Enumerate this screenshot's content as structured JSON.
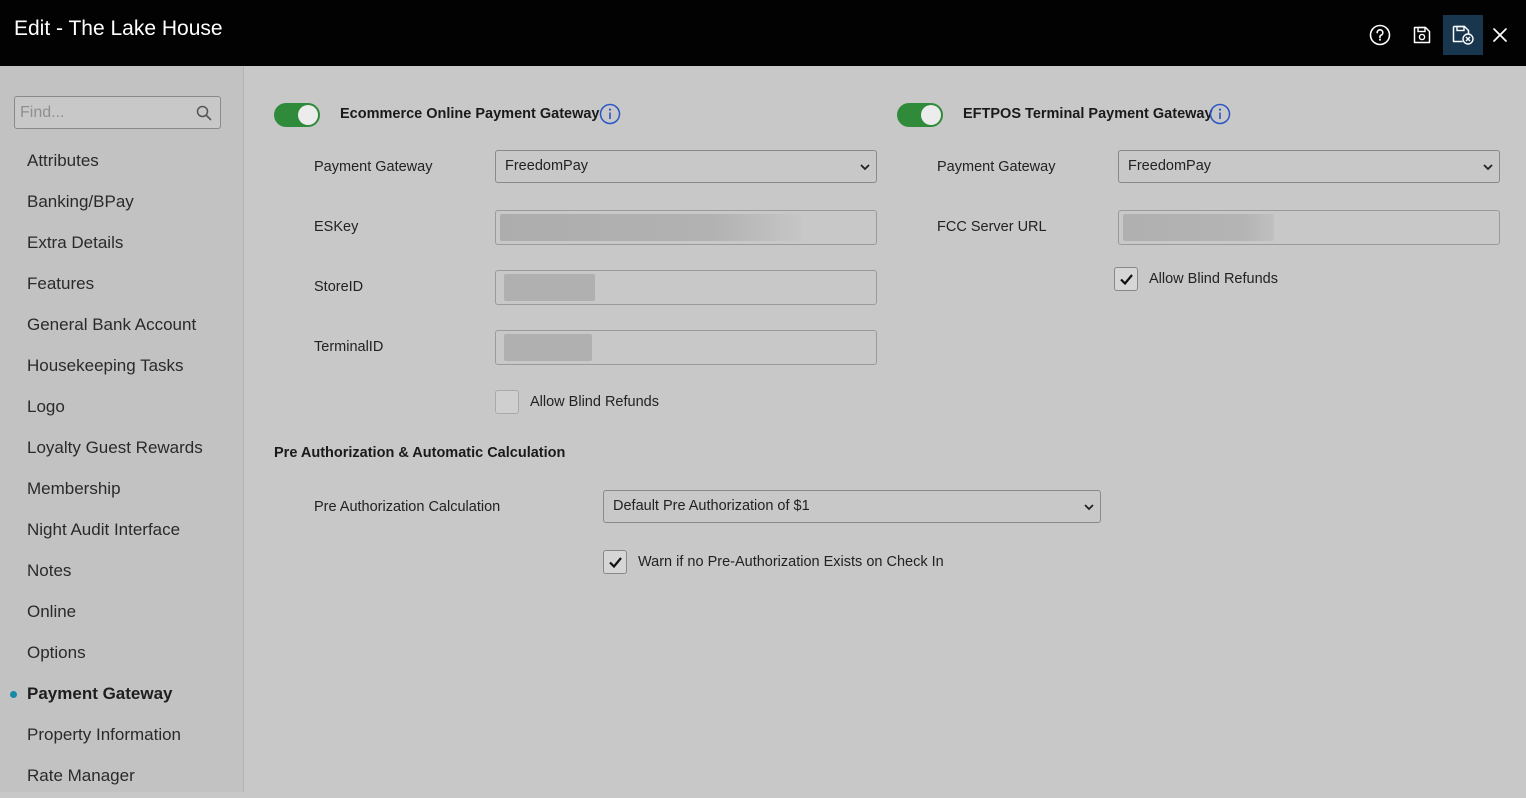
{
  "window": {
    "title": "Edit - The Lake House"
  },
  "toolbar": {
    "icons": [
      "help-icon",
      "save-icon",
      "save-close-icon",
      "close-icon"
    ]
  },
  "sidebar": {
    "search_placeholder": "Find...",
    "items": [
      {
        "label": "Attributes",
        "active": false
      },
      {
        "label": "Banking/BPay",
        "active": false
      },
      {
        "label": "Extra Details",
        "active": false
      },
      {
        "label": "Features",
        "active": false
      },
      {
        "label": "General Bank Account",
        "active": false
      },
      {
        "label": "Housekeeping Tasks",
        "active": false
      },
      {
        "label": "Logo",
        "active": false
      },
      {
        "label": "Loyalty Guest Rewards",
        "active": false
      },
      {
        "label": "Membership",
        "active": false
      },
      {
        "label": "Night Audit Interface",
        "active": false
      },
      {
        "label": "Notes",
        "active": false
      },
      {
        "label": "Online",
        "active": false
      },
      {
        "label": "Options",
        "active": false
      },
      {
        "label": "Payment Gateway",
        "active": true
      },
      {
        "label": "Property Information",
        "active": false
      },
      {
        "label": "Rate Manager",
        "active": false
      }
    ]
  },
  "ecommerce": {
    "enabled": true,
    "title": "Ecommerce Online Payment Gateway",
    "gateway_label": "Payment Gateway",
    "gateway_value": "FreedomPay",
    "eskey_label": "ESKey",
    "storeid_label": "StoreID",
    "terminalid_label": "TerminalID",
    "blind_refunds_label": "Allow Blind Refunds",
    "blind_refunds_checked": false
  },
  "eftpos": {
    "enabled": true,
    "title": "EFTPOS Terminal Payment Gateway",
    "gateway_label": "Payment Gateway",
    "gateway_value": "FreedomPay",
    "fcc_label": "FCC Server URL",
    "blind_refunds_label": "Allow Blind Refunds",
    "blind_refunds_checked": true
  },
  "preauth": {
    "title": "Pre Authorization & Automatic Calculation",
    "calc_label": "Pre Authorization Calculation",
    "calc_value": "Default Pre Authorization of $1",
    "warn_label": "Warn if no Pre-Authorization Exists on Check In",
    "warn_checked": true
  },
  "colors": {
    "accent": "#1689a6",
    "toggle_on": "#2f8a3a",
    "titlebar": "#020202",
    "info_icon": "#2a56c6"
  }
}
